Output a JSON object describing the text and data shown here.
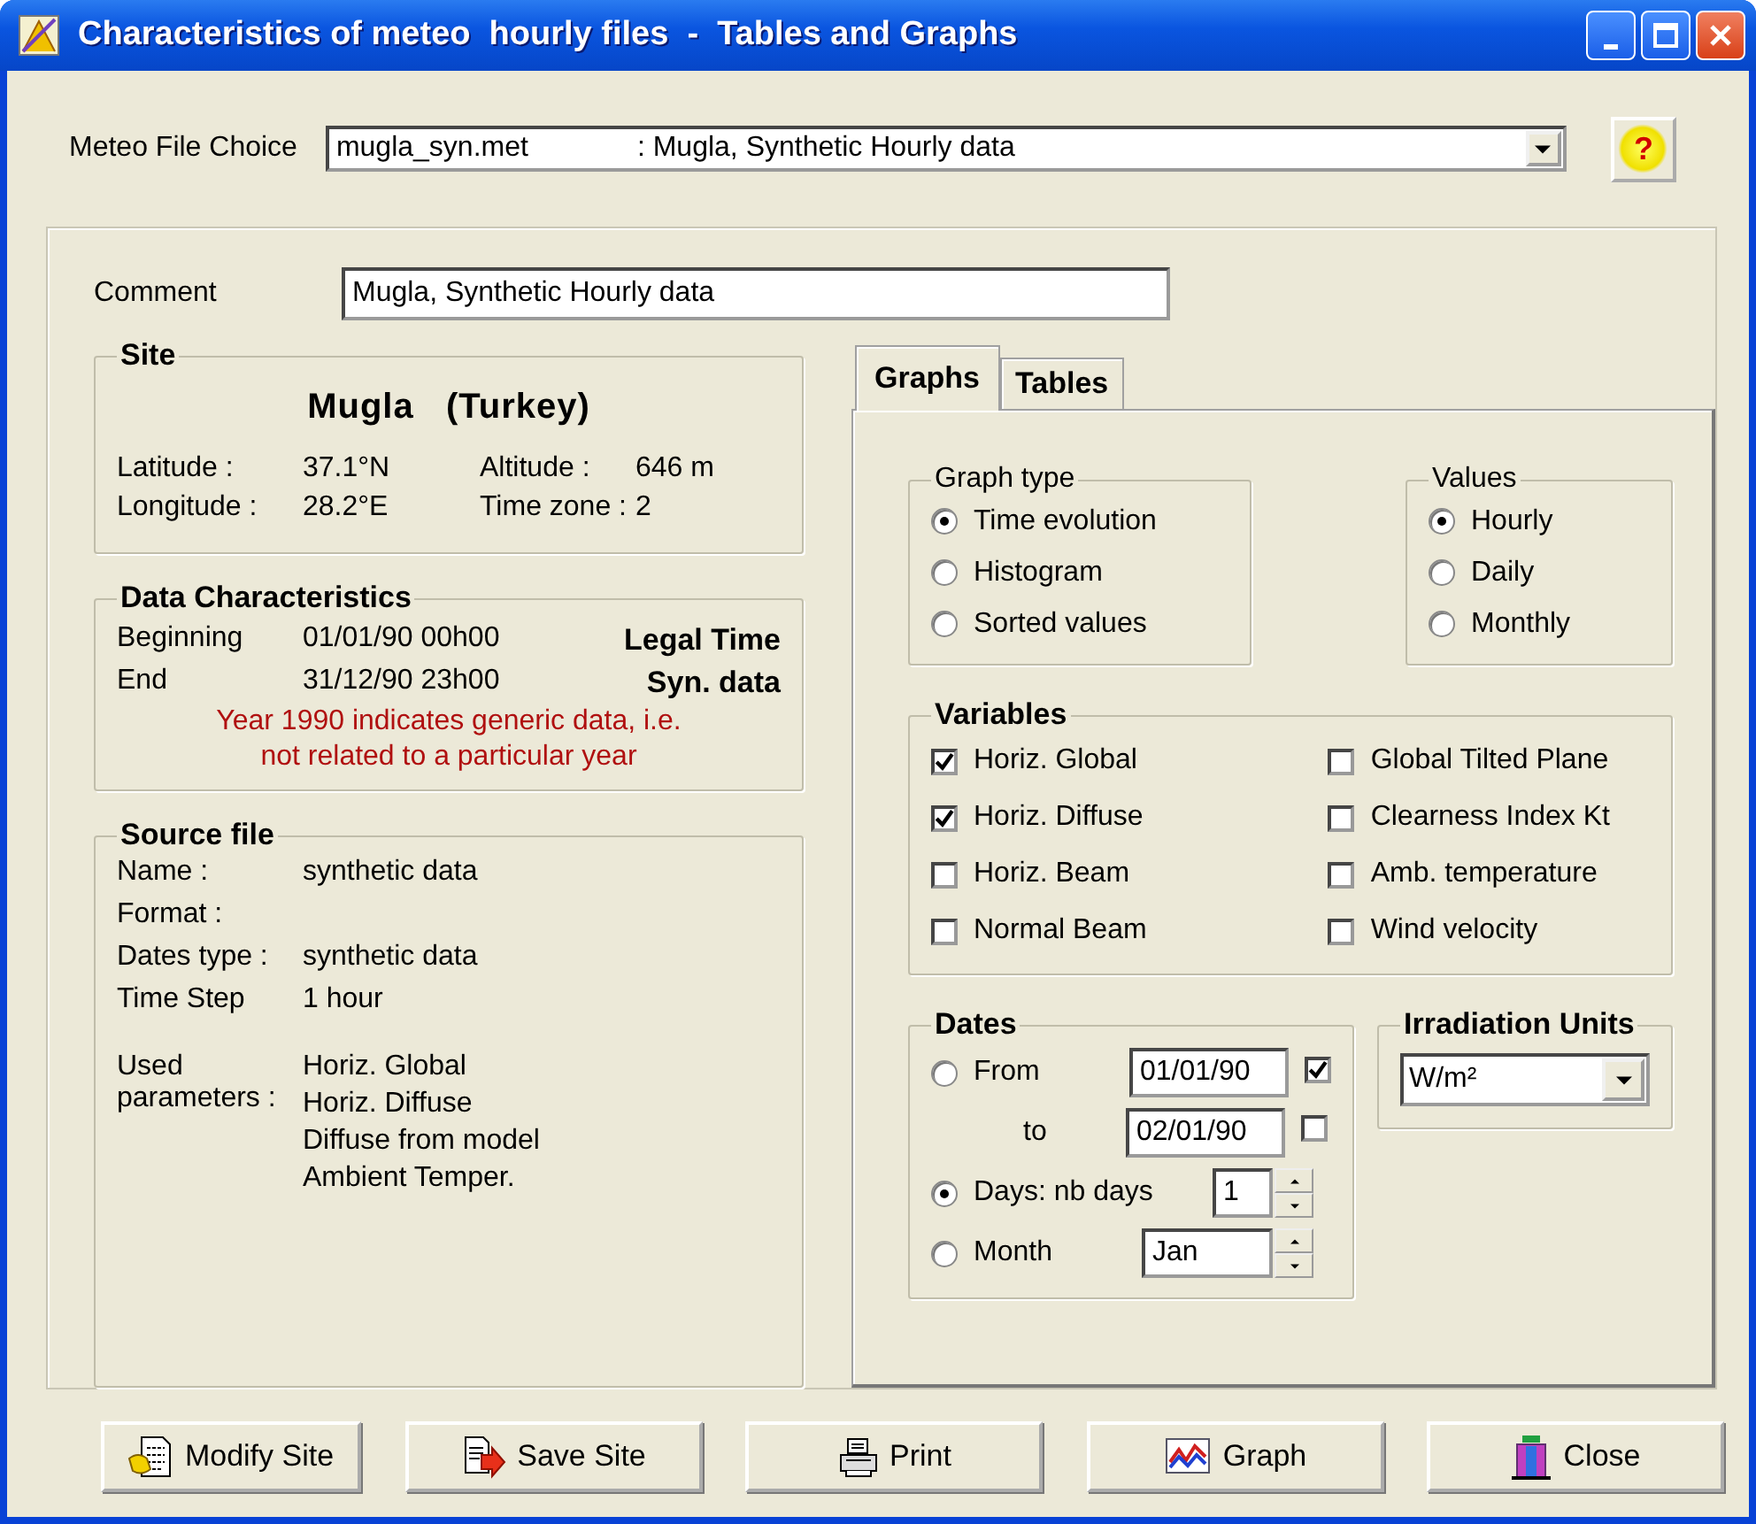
{
  "window": {
    "title": "Characteristics of meteo  hourly files  -  Tables and Graphs"
  },
  "meteo_file_choice": {
    "label": "Meteo File Choice",
    "file": "mugla_syn.met",
    "description": ": Mugla, Synthetic Hourly data"
  },
  "help_button": {
    "label": "?"
  },
  "comment": {
    "label": "Comment",
    "value": "Mugla, Synthetic Hourly data"
  },
  "site": {
    "title": "Site",
    "name": "Mugla   (Turkey)",
    "rows": [
      [
        {
          "label": "Latitude :",
          "value": "37.1°N"
        },
        {
          "label": "Altitude :",
          "value": "646 m"
        }
      ],
      [
        {
          "label": "Longitude :",
          "value": "28.2°E"
        },
        {
          "label": "Time zone :",
          "value": "2"
        }
      ]
    ]
  },
  "data_characteristics": {
    "title": "Data Characteristics",
    "rows": [
      {
        "label": "Beginning",
        "value": "01/01/90 00h00",
        "note": "Legal Time"
      },
      {
        "label": "End",
        "value": "31/12/90 23h00",
        "note": "Syn. data"
      }
    ],
    "remark": "Year 1990 indicates generic data, i.e.\nnot related to a particular year"
  },
  "source_file": {
    "title": "Source file",
    "rows": [
      {
        "label": "Name :",
        "value": "synthetic data"
      },
      {
        "label": "Format :"
      },
      {
        "label": "Dates type :",
        "value": "synthetic data"
      },
      {
        "label": "Time Step",
        "value": "1 hour"
      }
    ],
    "used_parameters": {
      "label": "Used parameters :",
      "values": [
        "Horiz. Global",
        "Horiz. Diffuse",
        "Diffuse from model",
        "Ambient Temper."
      ]
    }
  },
  "tabs": [
    {
      "label": "Graphs",
      "selected": true
    },
    {
      "label": "Tables",
      "selected": false
    }
  ],
  "graph_type": {
    "title": "Graph type",
    "options": [
      {
        "label": "Time evolution",
        "selected": true
      },
      {
        "label": "Histogram",
        "selected": false
      },
      {
        "label": "Sorted values",
        "selected": false
      }
    ]
  },
  "values": {
    "title": "Values",
    "options": [
      {
        "label": "Hourly",
        "selected": true
      },
      {
        "label": "Daily",
        "selected": false
      },
      {
        "label": "Monthly",
        "selected": false
      }
    ]
  },
  "variables": {
    "title": "Variables",
    "items": [
      {
        "label": "Horiz. Global",
        "checked": true
      },
      {
        "label": "Horiz. Diffuse",
        "checked": true
      },
      {
        "label": "Horiz. Beam",
        "checked": false
      },
      {
        "label": "Normal Beam",
        "checked": false
      },
      {
        "label": "Global Tilted Plane",
        "checked": false
      },
      {
        "label": "Clearness Index Kt",
        "checked": false
      },
      {
        "label": "Amb. temperature",
        "checked": false
      },
      {
        "label": "Wind velocity",
        "checked": false
      }
    ]
  },
  "dates": {
    "title": "Dates",
    "from": {
      "label": "From",
      "selected": false,
      "value": "01/01/90",
      "checked": true
    },
    "to": {
      "label": "to",
      "value": "02/01/90",
      "checked": false
    },
    "days": {
      "label": "Days: nb days",
      "selected": true,
      "value": "1"
    },
    "month": {
      "label": "Month",
      "selected": false,
      "value": "Jan"
    }
  },
  "irradiation_units": {
    "title": "Irradiation Units",
    "value": "W/m²"
  },
  "buttons": [
    {
      "kind": "modify",
      "label": "Modify Site"
    },
    {
      "kind": "save",
      "label": "Save Site"
    },
    {
      "kind": "print",
      "label": "Print"
    },
    {
      "kind": "graph",
      "label": "Graph"
    },
    {
      "kind": "close",
      "label": "Close"
    }
  ]
}
